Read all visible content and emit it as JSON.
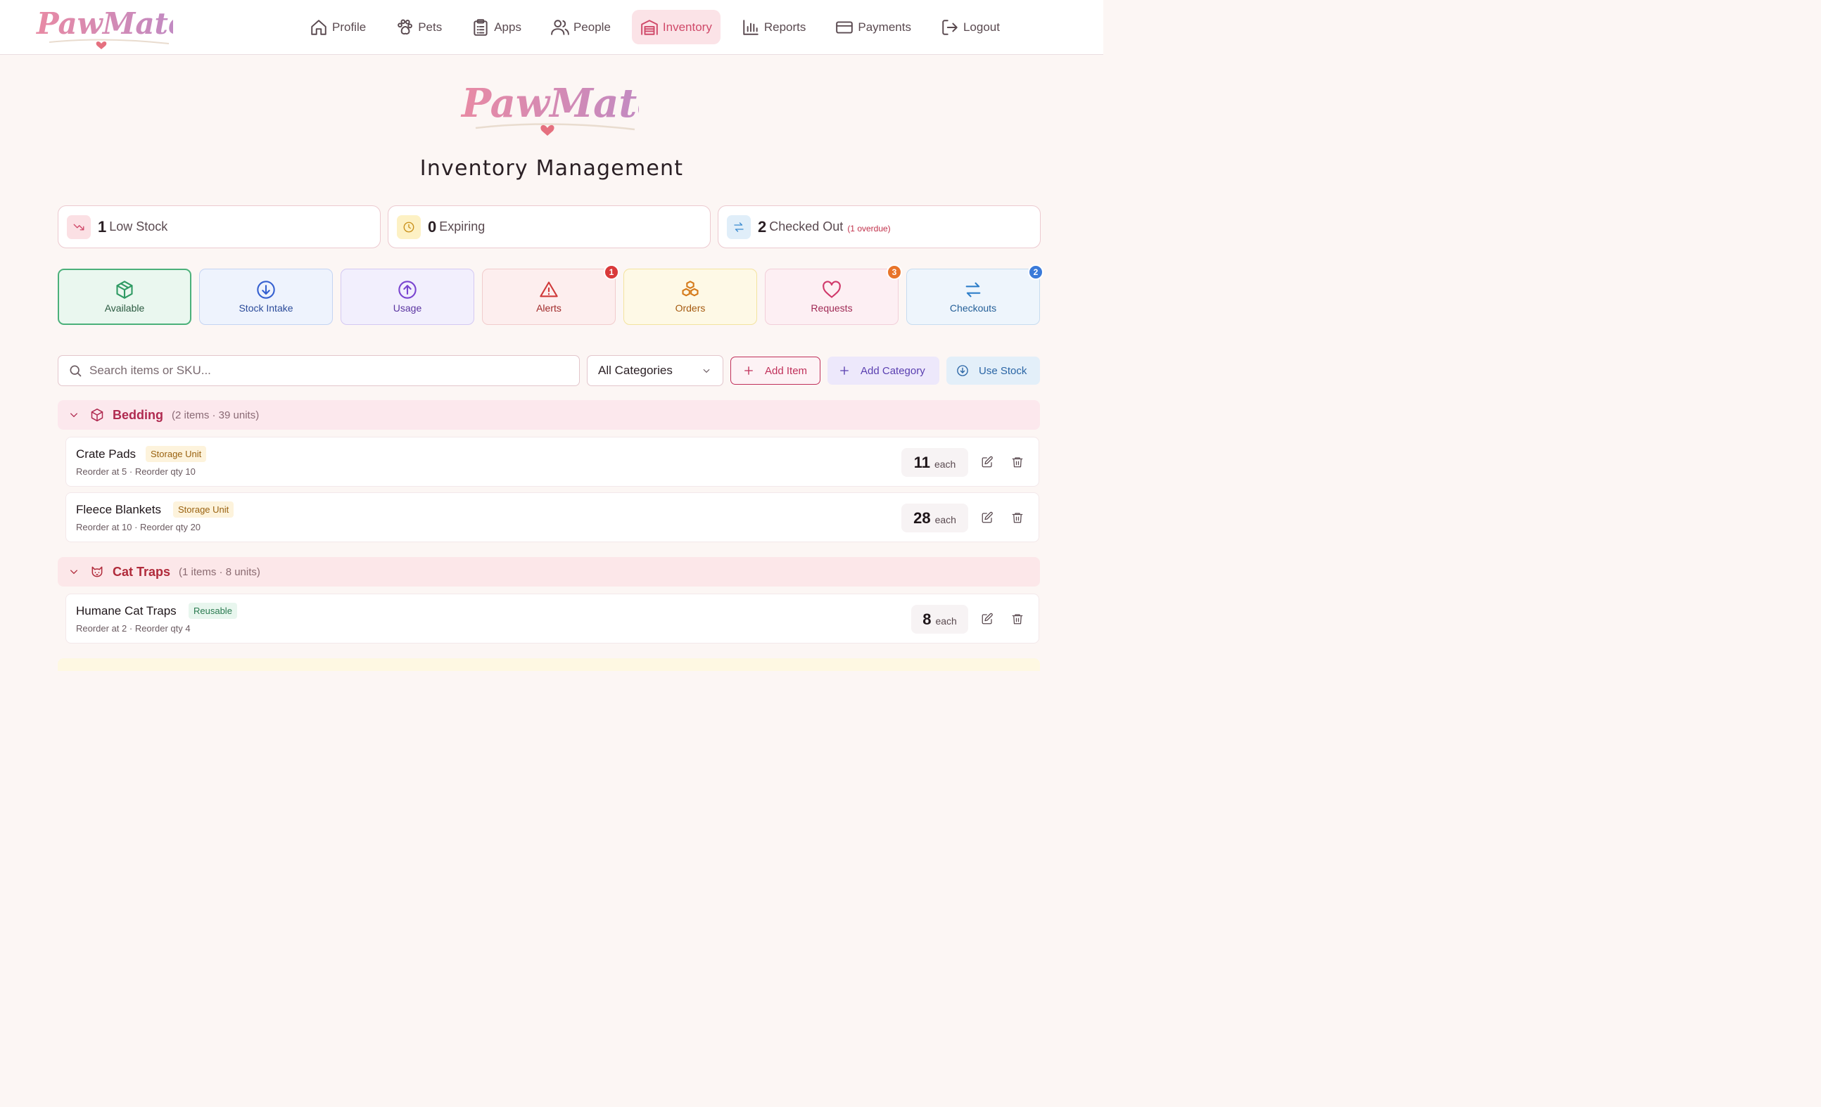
{
  "brand": {
    "name": "PawMates",
    "pink": "#e88aa4",
    "purple": "#b98ac9",
    "heart": "#e5707f"
  },
  "nav": {
    "items": [
      {
        "label": "Profile",
        "icon": "home-icon"
      },
      {
        "label": "Pets",
        "icon": "paw-icon"
      },
      {
        "label": "Apps",
        "icon": "clipboard-icon"
      },
      {
        "label": "People",
        "icon": "users-icon"
      },
      {
        "label": "Inventory",
        "icon": "warehouse-icon",
        "active": true
      },
      {
        "label": "Reports",
        "icon": "bar-chart-icon"
      },
      {
        "label": "Payments",
        "icon": "credit-card-icon"
      },
      {
        "label": "Logout",
        "icon": "logout-icon"
      }
    ]
  },
  "page": {
    "title": "Inventory Management"
  },
  "stats": {
    "low_stock": {
      "value": "1",
      "label": "Low Stock",
      "icon": "trending-down-icon"
    },
    "expiring": {
      "value": "0",
      "label": "Expiring",
      "icon": "clock-icon"
    },
    "checked_out": {
      "value": "2",
      "label": "Checked Out",
      "sub": "(1 overdue)",
      "icon": "swap-icon"
    }
  },
  "tiles": {
    "available": {
      "label": "Available",
      "icon": "box-icon"
    },
    "stock_intake": {
      "label": "Stock Intake",
      "icon": "arrow-down-circle-icon"
    },
    "usage": {
      "label": "Usage",
      "icon": "arrow-up-circle-icon"
    },
    "alerts": {
      "label": "Alerts",
      "icon": "warning-icon",
      "badge": "1"
    },
    "orders": {
      "label": "Orders",
      "icon": "boxes-icon"
    },
    "requests": {
      "label": "Requests",
      "icon": "heart-icon",
      "badge": "3"
    },
    "checkouts": {
      "label": "Checkouts",
      "icon": "swap-icon",
      "badge": "2"
    }
  },
  "toolbar": {
    "search_placeholder": "Search items or SKU...",
    "category_select": "All Categories",
    "add_item": "Add Item",
    "add_category": "Add Category",
    "use_stock": "Use Stock"
  },
  "categories": [
    {
      "name": "Bedding",
      "meta": "(2 items · 39 units)",
      "icon": "package-icon",
      "items": [
        {
          "name": "Crate Pads",
          "tag": "Storage Unit",
          "meta": "Reorder at 5 · Reorder qty 10",
          "qty": "11",
          "unit": "each"
        },
        {
          "name": "Fleece Blankets",
          "tag": "Storage Unit",
          "meta": "Reorder at 10 · Reorder qty 20",
          "qty": "28",
          "unit": "each"
        }
      ]
    },
    {
      "name": "Cat Traps",
      "meta": "(1 items · 8 units)",
      "icon": "cat-icon",
      "items": [
        {
          "name": "Humane Cat Traps",
          "tag": "Reusable",
          "meta": "Reorder at 2 · Reorder qty 4",
          "qty": "8",
          "unit": "each"
        }
      ]
    }
  ]
}
